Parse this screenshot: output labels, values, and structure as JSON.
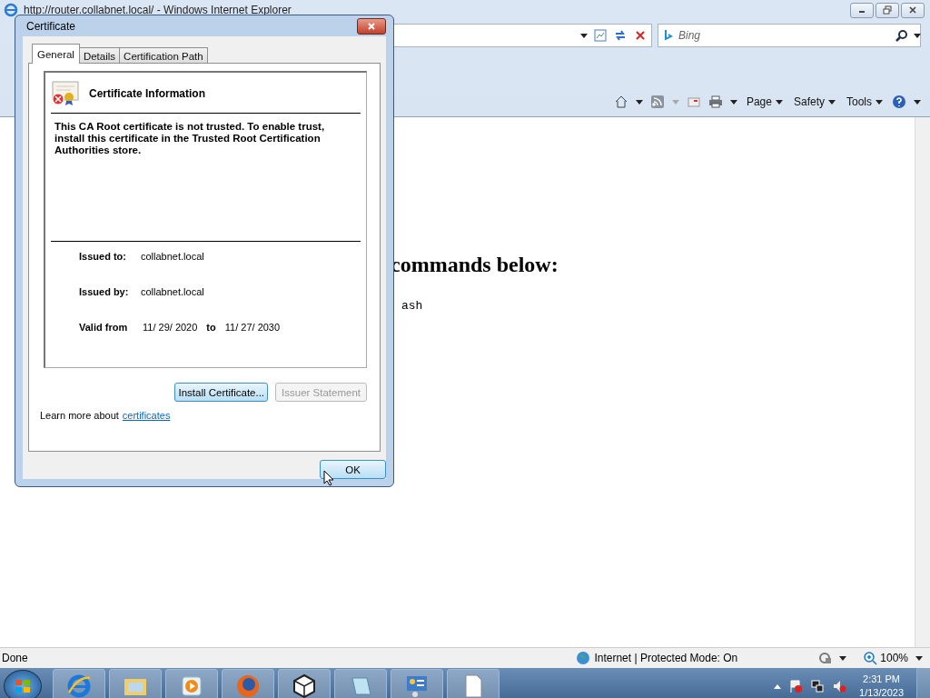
{
  "browser": {
    "title": "http://router.collabnet.local/ - Windows Internet Explorer",
    "search": {
      "placeholder": "Bing"
    },
    "command_bar": [
      "Page",
      "Safety",
      "Tools"
    ]
  },
  "page": {
    "heading_fragment": "commands below:",
    "code_fragment": "ash"
  },
  "dialog": {
    "title": "Certificate",
    "tabs": [
      {
        "label": "General",
        "selected": true
      },
      {
        "label": "Details",
        "selected": false
      },
      {
        "label": "Certification Path",
        "selected": false
      }
    ],
    "heading": "Certificate Information",
    "message": "This CA Root certificate is not trusted. To enable trust, install this certificate in the Trusted Root Certification Authorities store.",
    "fields": [
      {
        "label": "Issued to:",
        "value": "collabnet.local"
      },
      {
        "label": "Issued by:",
        "value": "collabnet.local"
      }
    ],
    "validity": {
      "label": "Valid from",
      "from": "11/ 29/ 2020",
      "to_label": "to",
      "to": "11/ 27/ 2030"
    },
    "buttons": [
      {
        "label": "Install Certificate...",
        "disabled": false
      },
      {
        "label": "Issuer Statement",
        "disabled": true
      }
    ],
    "learn_more": {
      "text": "Learn more about",
      "link": "certificates"
    },
    "ok": "OK"
  },
  "status_bar": {
    "text": "Done",
    "zone": "Internet | Protected Mode: On",
    "zoom": "100%"
  },
  "taskbar": {
    "items": [
      {
        "kind": "ie"
      },
      {
        "kind": "folder"
      },
      {
        "kind": "media"
      },
      {
        "kind": "firefox"
      },
      {
        "kind": "cube"
      },
      {
        "kind": "notepad"
      },
      {
        "kind": "panel"
      },
      {
        "kind": "document"
      }
    ],
    "time": "2:31 PM",
    "date": "1/13/2023"
  }
}
